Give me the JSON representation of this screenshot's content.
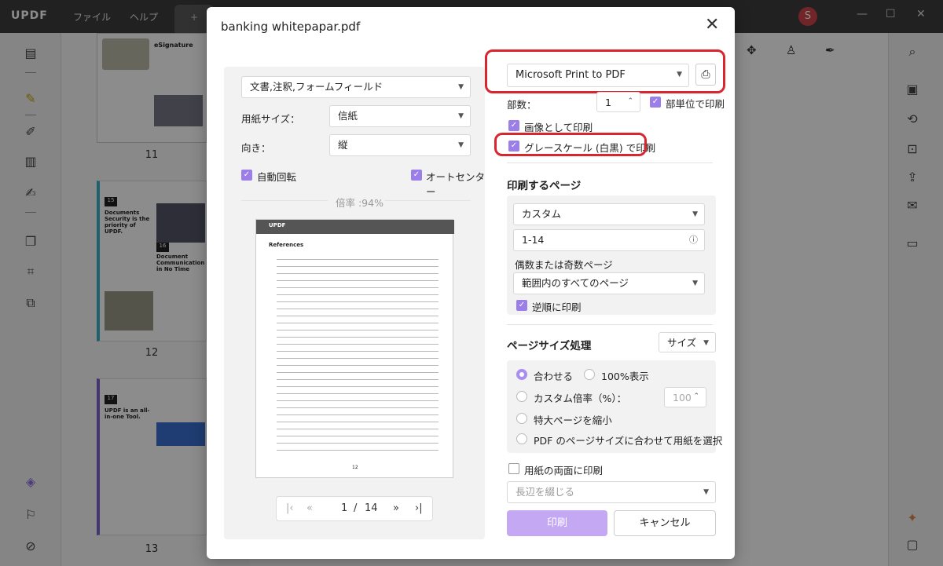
{
  "app": {
    "logo": "UPDF",
    "menu": [
      "ファイル",
      "ヘルプ"
    ],
    "new_tab": "+",
    "avatar_initial": "S",
    "window_controls": [
      "—",
      "☐",
      "✕"
    ]
  },
  "thumbnails": [
    {
      "label": "11",
      "heading": "eSignature"
    },
    {
      "label": "12",
      "heading": "Documents Security is the priority of UPDF.",
      "badge": "15",
      "heading2": "Document Communication in No Time",
      "badge2": "16"
    },
    {
      "label": "13",
      "heading": "UPDF is an all-in-one Tool.",
      "badge": "17"
    }
  ],
  "dialog": {
    "title": "banking whitepapar.pdf",
    "close": "✕",
    "left": {
      "content_select": "文書,注釈,フォームフィールド",
      "paper_size_label": "用紙サイズ：",
      "paper_size_value": "信紙",
      "orientation_label": "向き：",
      "orientation_value": "縦",
      "auto_rotate": "自動回転",
      "auto_center": "オートセンター",
      "zoom_label": "倍率 :94%",
      "preview_logo": "UPDF",
      "preview_heading": "References",
      "preview_page_number": "12",
      "pager": {
        "first": "|‹",
        "prev": "«",
        "current": "1",
        "separator": "/",
        "total": "14",
        "next": "»",
        "last": "›|"
      }
    },
    "right": {
      "printer": "Microsoft Print to PDF",
      "copies_label": "部数：",
      "copies_value": "1",
      "collate": "部単位で印刷",
      "print_as_image": "画像として印刷",
      "grayscale": "グレースケール (白黒) で印刷",
      "pages_section": "印刷するページ",
      "pages_mode": "カスタム",
      "pages_range": "1-14",
      "odd_even_label": "偶数または奇数ページ",
      "odd_even_value": "範囲内のすべてのページ",
      "reverse": "逆順に印刷",
      "size_section": "ページサイズ処理",
      "size_mode": "サイズ",
      "fit": "合わせる",
      "actual_size": "100%表示",
      "custom_scale": "カスタム倍率（%）：",
      "custom_scale_value": "100",
      "shrink": "特大ページを縮小",
      "pdf_size": "PDF のページサイズに合わせて用紙を選択",
      "duplex": "用紙の両面に印刷",
      "binding": "長辺を綴じる",
      "print_button": "印刷",
      "cancel_button": "キャンセル"
    }
  },
  "colors": {
    "accent": "#9b7ee8",
    "highlight": "#d9262e",
    "print_button": "#c5a8f4"
  }
}
